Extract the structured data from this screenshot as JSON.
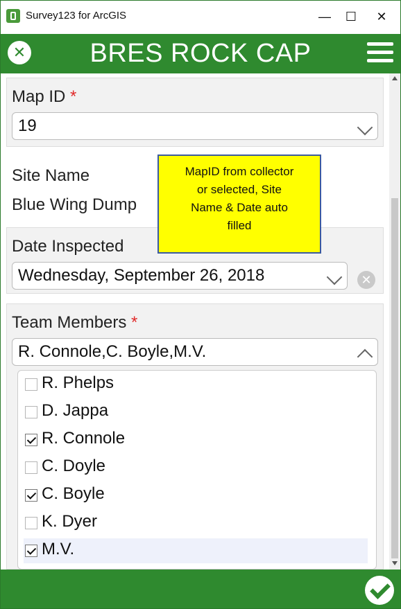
{
  "window": {
    "title": "Survey123 for ArcGIS",
    "minimize_glyph": "—",
    "maximize_glyph": "☐",
    "close_glyph": "✕"
  },
  "header": {
    "title": "BRES ROCK CAP",
    "close_glyph": "✕"
  },
  "form": {
    "map_id": {
      "label": "Map ID",
      "required_mark": "*",
      "value": "19"
    },
    "site_name": {
      "label": "Site Name",
      "value": "Blue Wing Dump"
    },
    "date_inspected": {
      "label": "Date Inspected",
      "value": "Wednesday, September 26, 2018",
      "clear_glyph": "✕"
    },
    "team_members": {
      "label": "Team Members",
      "required_mark": "*",
      "value": "R. Connole,C. Boyle,M.V.",
      "options": [
        {
          "label": "R. Phelps",
          "checked": false
        },
        {
          "label": "D. Jappa",
          "checked": false
        },
        {
          "label": "R. Connole",
          "checked": true
        },
        {
          "label": "C. Doyle",
          "checked": false
        },
        {
          "label": "C. Boyle",
          "checked": true
        },
        {
          "label": "K. Dyer",
          "checked": false
        },
        {
          "label": "M.V.",
          "checked": true
        }
      ]
    }
  },
  "callout": {
    "text": "MapID from collector\nor selected, Site\nName & Date auto\nfilled"
  },
  "colors": {
    "brand_green": "#2f8a2f",
    "required_red": "#e02a2a",
    "callout_yellow": "#ffff00",
    "callout_border": "#3b5aa0"
  },
  "icons": {
    "close": "close-icon",
    "menu": "hamburger-menu-icon",
    "submit": "checkmark-icon",
    "dropdown": "chevron-down-icon"
  }
}
